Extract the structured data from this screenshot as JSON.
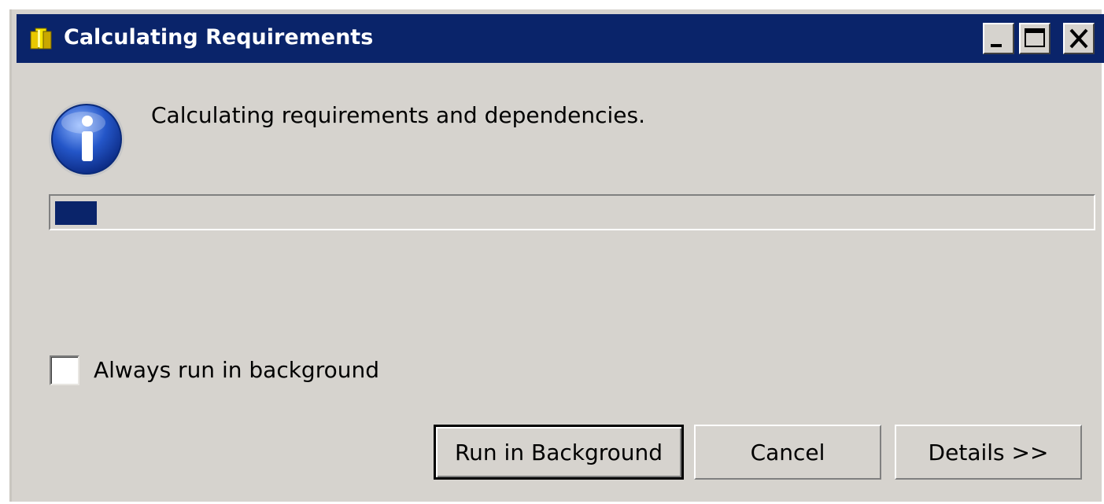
{
  "window": {
    "title": "Calculating Requirements",
    "title_icon": "package-icon",
    "controls": {
      "minimize_icon": "minimize-icon",
      "maximize_icon": "maximize-icon",
      "close_icon": "close-icon"
    }
  },
  "body": {
    "icon": "info-icon",
    "message": "Calculating requirements and dependencies.",
    "progress": 0.04
  },
  "options": {
    "always_background_label": "Always run in background",
    "always_background_checked": false
  },
  "buttons": {
    "run_in_background": "Run in Background",
    "cancel": "Cancel",
    "details": "Details >>"
  },
  "colors": {
    "titlebar": "#0a246a",
    "face": "#d6d3ce",
    "progress": "#0a246a"
  }
}
